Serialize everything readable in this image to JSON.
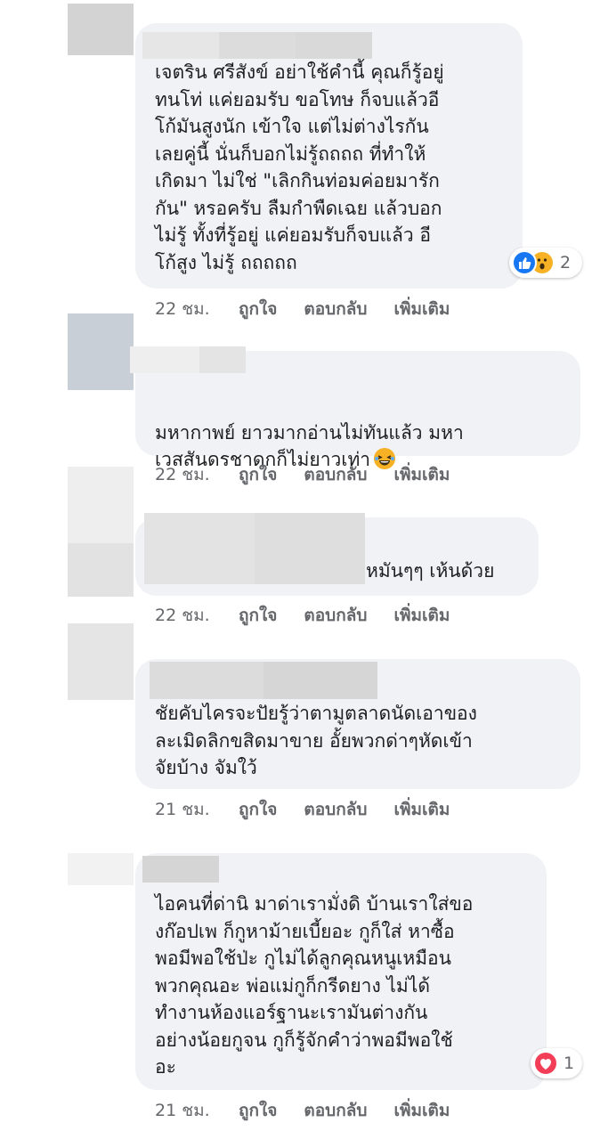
{
  "comments": [
    {
      "text": "เจตริน ศรีสังข์ อย่าใช้คำนี้ คุณก็รู้อยู่\nทนโท่ แค่ยอมรับ ขอโทษ ก็จบแล้วอี\nโก้มันสูงนัก เข้าใจ แต่ไม่ต่างไรกัน\nเลยคู่นี้ นั่นก็บอกไม่รู้ถถถถ ที่ทำให้\nเกิดมา ไม่ใช่ \"เลิกกินท่อมค่อยมารัก\nกัน\" หรอครับ ลืมกำพืดเฉย แล้วบอก\nไม่รู้ ทั้งที่รู้อยู่ แค่ยอมรับก็จบแล้ว อี\nโก้สูง ไม่รู้ ถถถถถ",
      "time": "22 ชม.",
      "reaction_count": "2"
    },
    {
      "text": "มหากาพย์ ยาวมากอ่านไม่ทันแล้ว มหา\nเวสสันดรชาดกก็ไม่ยาวเท่า",
      "time": "22 ชม."
    },
    {
      "text": "หมันๆๆ เห้นด้วย",
      "time": "22 ชม."
    },
    {
      "text": "ชัยคับไครจะปัยรู้ว่าตามูตลาดนัดเอาของ\nละเมิดลิกขสิดมาขาย อั้ยพวกด่าๆหัดเข้า\nจัยบ้าง จัมใว้",
      "time": "21 ชม."
    },
    {
      "text": "ไอคนที่ด่านิ มาด่าเรามั่งดิ บ้านเราใส่ขอ\nงก๊อปเพ ก็กูหาม้ายเบี้ยอะ กูก็ใส่ หาซื้อ\nพอมีพอใช้ป่ะ กูไม่ได้ลูกคุณหนูเหมือน\nพวกคุณอะ พ่อแม่กูก็กรีดยาง ไม่ได้\nทำงานห้องแอร์ฐานะเรามันต่างกัน\nอย่างน้อยกูจน กูก็รู้จักคำว่าพอมีพอใช้\nอะ",
      "time": "21 ชม.",
      "reaction_count": "1"
    }
  ],
  "actions": {
    "like": "ถูกใจ",
    "reply": "ตอบกลับ",
    "more": "เพิ่มเติม"
  },
  "icons": {
    "like": "thumbs-up-icon",
    "wow": "wow-face-icon",
    "love": "heart-icon",
    "laugh": "laughing-tears-emoji-icon"
  },
  "colors": {
    "bubble": "#f0f2f5",
    "text": "#1c1e21",
    "meta": "#65676b",
    "like_blue": "#1877f2",
    "love_red": "#f33e58",
    "wow_yellow": "#f7b125"
  }
}
